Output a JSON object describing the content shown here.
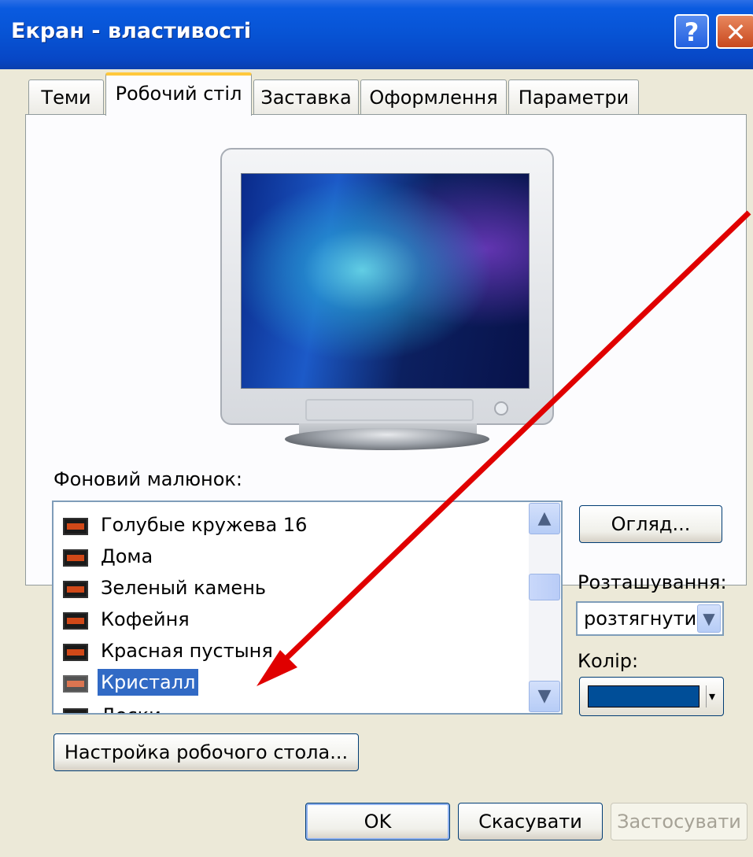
{
  "window": {
    "title": "Екран - властивості"
  },
  "titlebar": {
    "help_glyph": "?",
    "close_glyph": "✕"
  },
  "tabs": [
    {
      "label": "Теми"
    },
    {
      "label": "Робочий стіл",
      "active": true
    },
    {
      "label": "Заставка"
    },
    {
      "label": "Оформлення"
    },
    {
      "label": "Параметри"
    }
  ],
  "wallpaper_section": {
    "label": "Фоновий малюнок:",
    "items": [
      {
        "name": "Голубые кружева 16"
      },
      {
        "name": "Дома"
      },
      {
        "name": "Зеленый камень"
      },
      {
        "name": "Кофейня"
      },
      {
        "name": "Красная пустыня"
      },
      {
        "name": "Кристалл",
        "selected": true
      },
      {
        "name": "Доски"
      }
    ],
    "browse_button": "Огляд...",
    "position_label": "Розташування:",
    "position_value": "розтягнути",
    "color_label": "Колір:",
    "color_value": "#004E98",
    "customize_button": "Настройка робочого стола..."
  },
  "footer": {
    "ok": "OK",
    "cancel": "Скасувати",
    "apply": "Застосувати"
  },
  "annotation": {
    "color": "#E00000"
  }
}
